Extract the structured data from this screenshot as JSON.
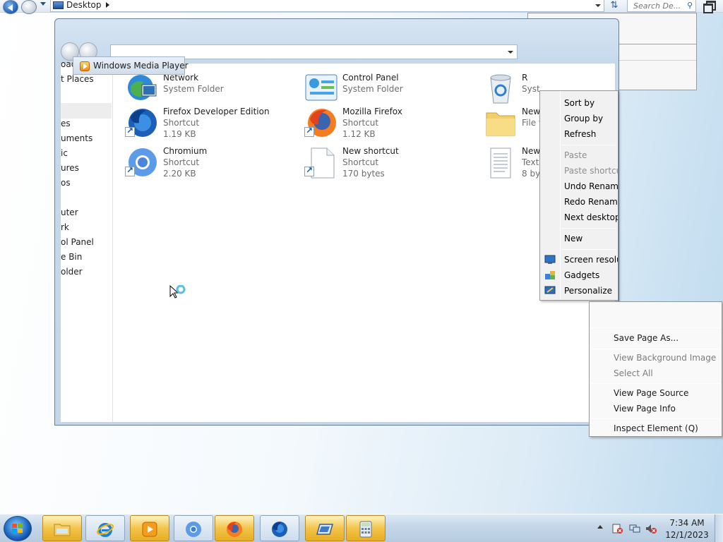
{
  "topbar": {
    "location": "Desktop",
    "search_placeholder": "Search De..."
  },
  "window": {
    "tooltip": "Windows Media Player",
    "nav_pane": [
      "oad",
      "t Places",
      "es",
      "uments",
      "ic",
      "ures",
      "os",
      "uter",
      "rk",
      "ol Panel",
      "e Bin",
      "older"
    ],
    "items": [
      {
        "name": "Network",
        "line2": "System Folder",
        "line3": ""
      },
      {
        "name": "Control Panel",
        "line2": "System Folder",
        "line3": ""
      },
      {
        "name": "R",
        "line2": "Syst",
        "line3": ""
      },
      {
        "name": "Firefox Developer Edition",
        "line2": "Shortcut",
        "line3": "1.19 KB"
      },
      {
        "name": "Mozilla Firefox",
        "line2": "Shortcut",
        "line3": "1.12 KB"
      },
      {
        "name": "New",
        "line2": "File f",
        "line3": ""
      },
      {
        "name": "Chromium",
        "line2": "Shortcut",
        "line3": "2.20 KB"
      },
      {
        "name": "New shortcut",
        "line2": "Shortcut",
        "line3": "170 bytes"
      },
      {
        "name": "New",
        "line2": "Text",
        "line3": "8 byt"
      }
    ]
  },
  "desktop_menu": {
    "items": [
      {
        "label": "Sort by",
        "disabled": false
      },
      {
        "label": "Group by",
        "disabled": false
      },
      {
        "label": "Refresh",
        "disabled": false
      },
      {
        "label": "Paste",
        "disabled": true
      },
      {
        "label": "Paste shortcut",
        "disabled": true
      },
      {
        "label": "Undo Rename",
        "disabled": false
      },
      {
        "label": "Redo Rename",
        "disabled": false
      },
      {
        "label": "Next desktop",
        "disabled": false
      },
      {
        "label": "New",
        "disabled": false
      },
      {
        "label": "Screen resolution",
        "disabled": false
      },
      {
        "label": "Gadgets",
        "disabled": false
      },
      {
        "label": "Personalize",
        "disabled": false
      }
    ]
  },
  "browser_menu": {
    "items": [
      {
        "label": "Save Page As...",
        "disabled": false
      },
      {
        "label": "View Background Image",
        "disabled": true
      },
      {
        "label": "Select All",
        "disabled": true
      },
      {
        "label": "View Page Source",
        "disabled": false
      },
      {
        "label": "View Page Info",
        "disabled": false
      },
      {
        "label": "Inspect Element (Q)",
        "disabled": false
      }
    ]
  },
  "taskbar": {
    "apps": [
      "Windows Explorer",
      "Internet Explorer",
      "Windows Media Player",
      "Chromium",
      "Firefox",
      "Firefox Developer Edition",
      "Remote Desktop",
      "Calculator"
    ],
    "time": "7:34 AM",
    "date": "12/1/2023"
  },
  "colors": {
    "accent": "#1d6bc4",
    "taskbar_highlight": "#f3c44a",
    "menu_bg": "#f1f1f1"
  }
}
